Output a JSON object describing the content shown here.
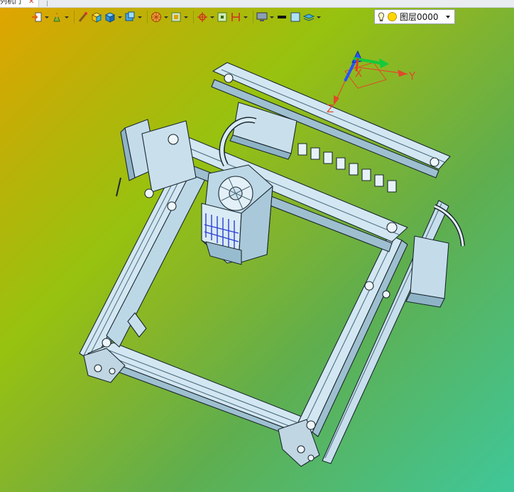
{
  "tab": {
    "label": "列机门",
    "close_glyph": "✕"
  },
  "toolbar": {
    "items": [
      {
        "name": "import-icon"
      },
      {
        "name": "material-icon"
      },
      {
        "name": "brush-icon"
      },
      {
        "name": "cube-yellow-icon"
      },
      {
        "name": "cube-blue-icon"
      },
      {
        "name": "view-cube-icon"
      },
      {
        "name": "sphere-icon"
      },
      {
        "name": "frame-icon"
      },
      {
        "name": "snap-icon"
      },
      {
        "name": "zoom-box-icon"
      },
      {
        "name": "measure-icon"
      },
      {
        "name": "monitor-icon"
      },
      {
        "name": "line-color-icon"
      },
      {
        "name": "fill-color-icon"
      },
      {
        "name": "layer-stack-icon"
      }
    ]
  },
  "layer": {
    "current": "图层0000",
    "bulb_icon": "lightbulb-icon",
    "state_icon": "layer-on-icon"
  },
  "axes": {
    "x": "X",
    "y": "Y",
    "z": "Z"
  },
  "colors": {
    "axis_x": "#e83c1a",
    "axis_y": "#15c93b",
    "axis_z": "#2455ff",
    "model": "#cfe6f3"
  }
}
